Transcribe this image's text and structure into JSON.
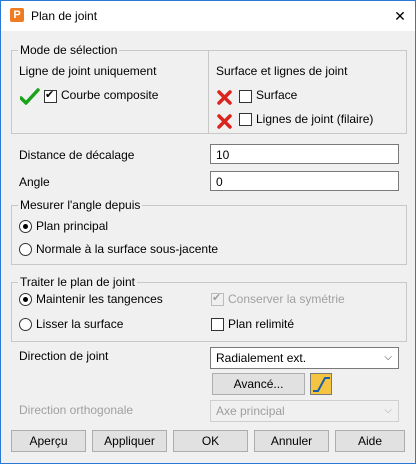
{
  "window": {
    "title": "Plan de joint",
    "app_icon": "P"
  },
  "selection": {
    "group_label": "Mode de sélection",
    "left_heading": "Ligne de joint uniquement",
    "courbe": "Courbe composite",
    "right_heading": "Surface et lignes de joint",
    "surface": "Surface",
    "lignes": "Lignes de joint (filaire)"
  },
  "distance": {
    "label": "Distance de décalage",
    "value": "10"
  },
  "angle": {
    "label": "Angle",
    "value": "0"
  },
  "measure": {
    "group_label": "Mesurer l'angle depuis",
    "plan_principal": "Plan principal",
    "normale": "Normale à la surface sous-jacente"
  },
  "treat": {
    "group_label": "Traiter le plan de joint",
    "maintenir": "Maintenir les tangences",
    "conserver": "Conserver la symétrie",
    "lisser": "Lisser la surface",
    "relimite": "Plan relimité"
  },
  "direction": {
    "label": "Direction de joint",
    "value": "Radialement ext."
  },
  "advanced_label": "Avancé...",
  "orthogonal": {
    "label": "Direction orthogonale",
    "value": "Axe principal"
  },
  "buttons": {
    "apercu": "Aperçu",
    "appliquer": "Appliquer",
    "ok": "OK",
    "annuler": "Annuler",
    "aide": "Aide"
  },
  "colors": {
    "accent": "#2b79d6",
    "check_green": "#1aa31a",
    "x_red": "#d9251d",
    "app_orange": "#f07c22"
  }
}
